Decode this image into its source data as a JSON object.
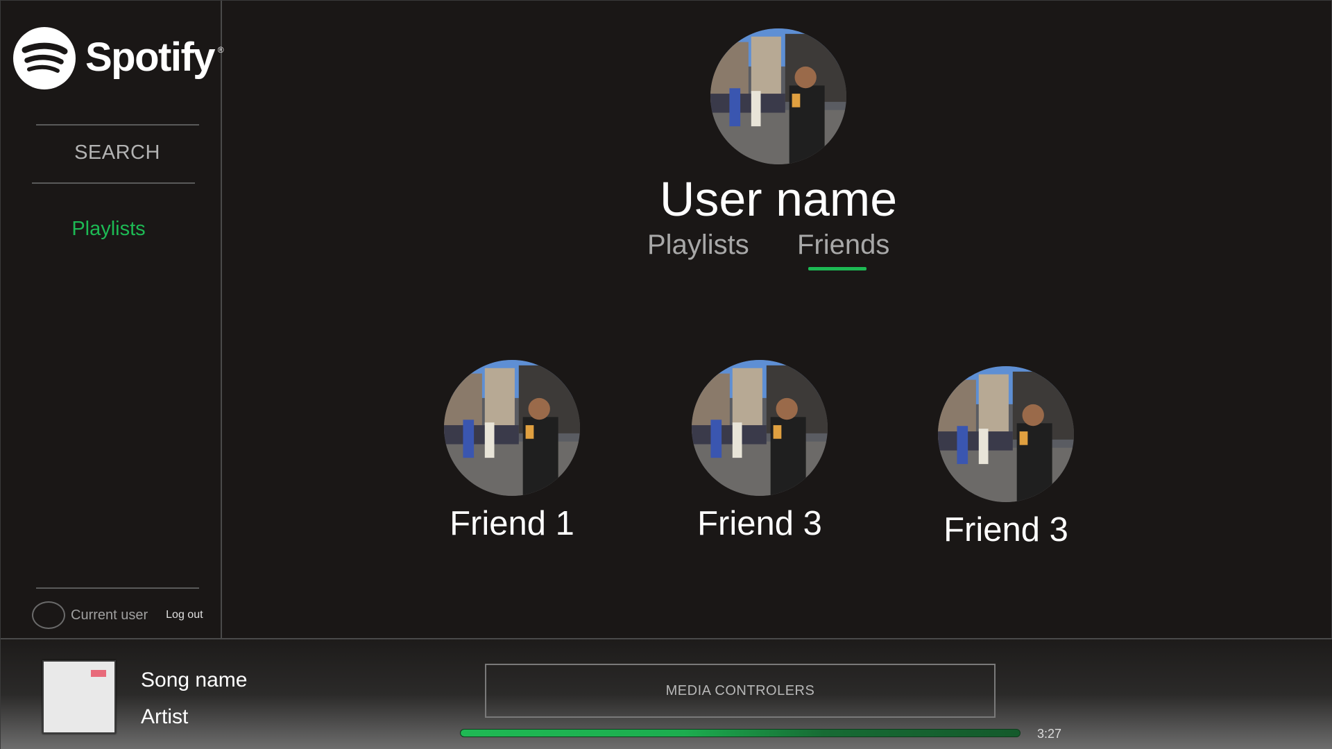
{
  "sidebar": {
    "logo_text": "Spotify",
    "logo_reg": "®",
    "search_label": "SEARCH",
    "playlists_label": "Playlists",
    "user": {
      "name": "Current user",
      "logout_label": "Log out"
    }
  },
  "profile": {
    "name": "User name",
    "tabs": [
      {
        "label": "Playlists",
        "active": false
      },
      {
        "label": "Friends",
        "active": true
      }
    ]
  },
  "friends": [
    {
      "name": "Friend 1"
    },
    {
      "name": "Friend 3"
    },
    {
      "name": "Friend 3"
    }
  ],
  "player": {
    "song_name": "Song name",
    "artist": "Artist",
    "media_controls_label": "MEDIA CONTROLERS",
    "duration": "3:27",
    "progress": 1.0
  },
  "colors": {
    "accent": "#1db954",
    "background": "#1a1716",
    "text_muted": "#a8a8a8"
  }
}
